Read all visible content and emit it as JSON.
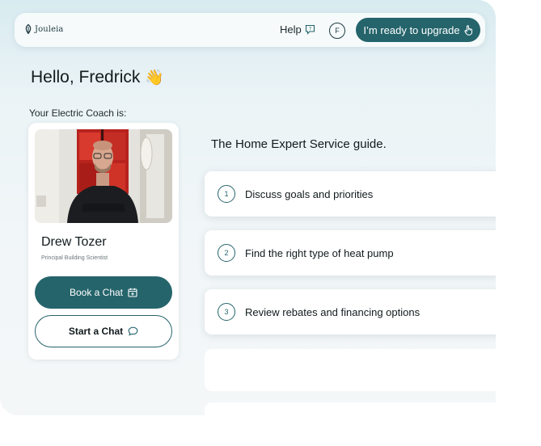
{
  "brand": {
    "name": "Jouleia",
    "accent": "#25646b"
  },
  "topbar": {
    "help_label": "Help",
    "help_icon": "help-bubble-icon",
    "avatar_initial": "F",
    "upgrade_label": "I’m ready to upgrade",
    "upgrade_icon": "pointer-hand-icon"
  },
  "greeting": {
    "text": "Hello, Fredrick",
    "emoji": "👋"
  },
  "coach": {
    "label": "Your Electric Coach is:",
    "name": "Drew Tozer",
    "title": "Principal Building Scientist",
    "book_label": "Book a Chat",
    "book_icon": "calendar-icon",
    "chat_label": "Start a Chat",
    "chat_icon": "chat-bubble-icon"
  },
  "guide": {
    "title": "The Home Expert Service guide.",
    "steps": [
      {
        "num": "1",
        "label": "Discuss goals and priorities"
      },
      {
        "num": "2",
        "label": "Find the right type of heat pump"
      },
      {
        "num": "3",
        "label": "Review rebates and financing options"
      }
    ]
  }
}
